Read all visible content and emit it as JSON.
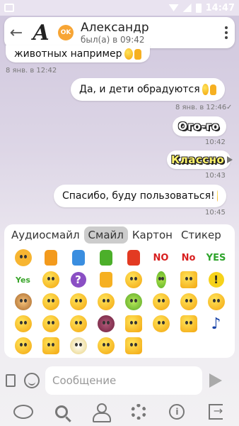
{
  "status_bar": {
    "time": "14:47"
  },
  "header": {
    "back_icon": "arrow-left-icon",
    "avatar_letter": "A",
    "badge_text": "OK",
    "contact_name": "Александр",
    "contact_status": "был(а) в 09:42",
    "menu_icon": "more-vertical-icon"
  },
  "messages": [
    {
      "text": "животных например",
      "time": "8 янв. в 12:42",
      "side": "left"
    },
    {
      "text": "Да, и дети обрадуются",
      "time": "8 янв. в 12:46",
      "side": "right"
    },
    {
      "sticker": "Ого-го",
      "time": "10:42",
      "side": "right"
    },
    {
      "sticker": "Классно",
      "time": "10:43",
      "side": "right"
    },
    {
      "text": "Спасибо, буду пользоваться!",
      "time": "10:45",
      "side": "right"
    }
  ],
  "smile_panel": {
    "tabs": [
      "Аудиосмайл",
      "Смайл",
      "Картон",
      "Стикер"
    ],
    "active_tab": "Смайл",
    "word_emojis": {
      "no1": "NO",
      "no2": "No",
      "yes1": "YES",
      "yes2": "Yes"
    },
    "question_mark": "?",
    "exclamation": "!"
  },
  "input": {
    "placeholder": "Сообщение"
  },
  "colors": {
    "accent_badge": "#f7a535",
    "background_top": "#cfc6dd",
    "bubble": "#ffffff"
  }
}
